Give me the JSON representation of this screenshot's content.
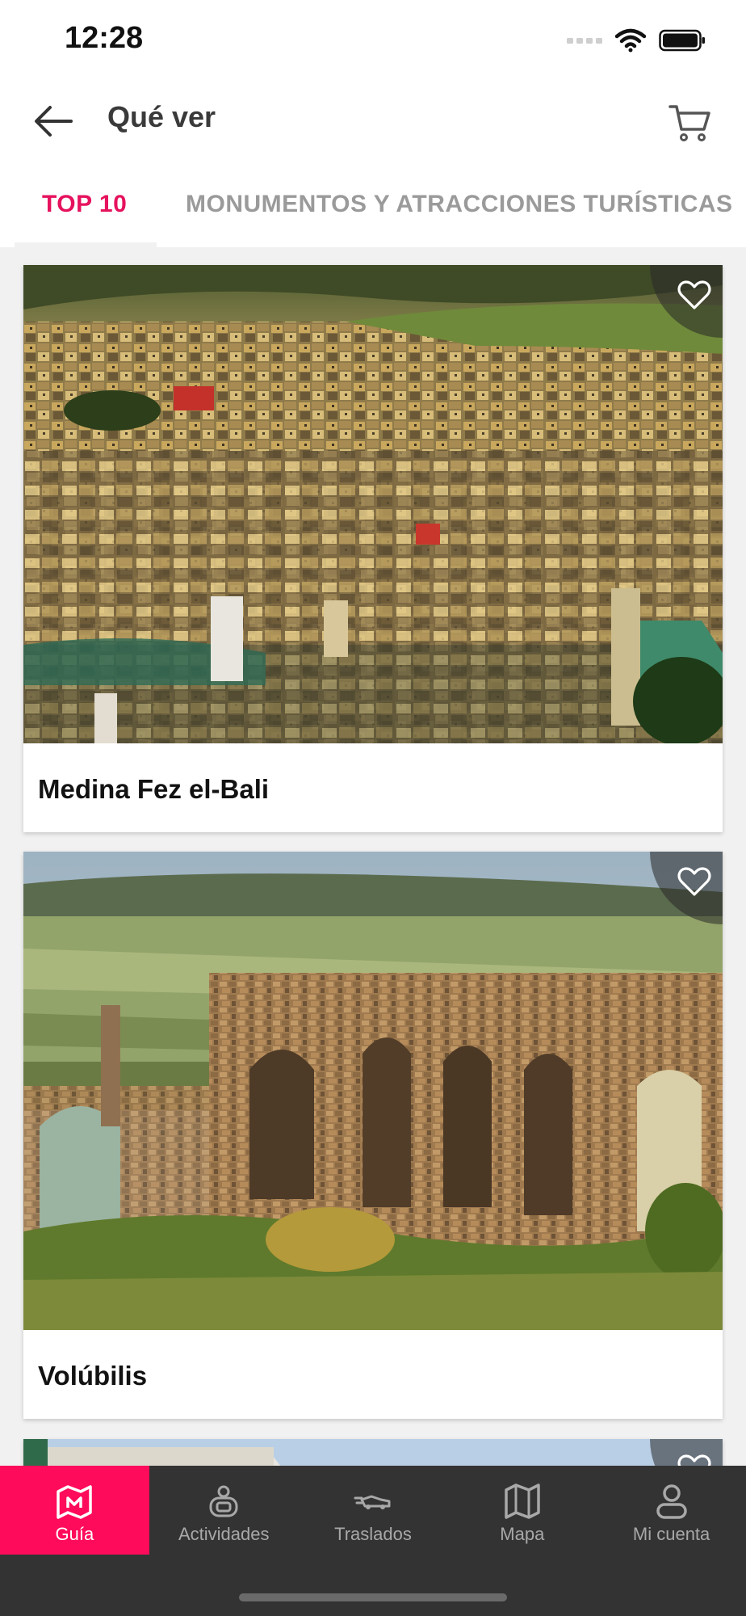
{
  "status_bar": {
    "time": "12:28"
  },
  "header": {
    "title": "Qué ver"
  },
  "tabs": [
    {
      "label": "TOP 10",
      "active": true
    },
    {
      "label": "MONUMENTOS Y ATRACCIONES TURÍSTICAS",
      "active": false
    }
  ],
  "cards": [
    {
      "title": "Medina Fez el-Bali",
      "favorite": false
    },
    {
      "title": "Volúbilis",
      "favorite": false
    }
  ],
  "bottom_nav": [
    {
      "label": "Guía",
      "icon": "map-pin-icon",
      "active": true
    },
    {
      "label": "Actividades",
      "icon": "activities-icon",
      "active": false
    },
    {
      "label": "Traslados",
      "icon": "car-icon",
      "active": false
    },
    {
      "label": "Mapa",
      "icon": "map-icon",
      "active": false
    },
    {
      "label": "Mi cuenta",
      "icon": "user-icon",
      "active": false
    }
  ],
  "colors": {
    "accent": "#e6125d",
    "nav_active": "#ff0b5b",
    "nav_bg": "#333333"
  }
}
